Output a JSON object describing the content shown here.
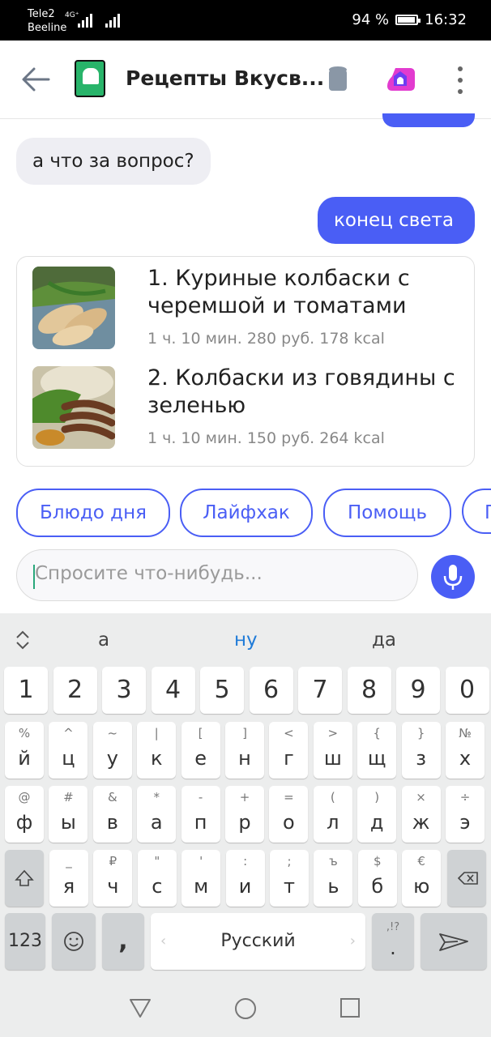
{
  "status_bar": {
    "carrier1": "Tele2",
    "carrier2": "Beeline",
    "network": "4G⁺",
    "battery": "94 %",
    "battery_level": 0.94,
    "time": "16:32"
  },
  "header": {
    "title": "Рецепты Вкусв...",
    "icons": [
      "back-arrow-icon",
      "app-logo-icon",
      "station-icon",
      "alice-icon",
      "more-icon"
    ]
  },
  "chat": {
    "incoming": "а что за вопрос?",
    "outgoing": "конец света",
    "recipes": [
      {
        "title": "1. Куриные колбаски с черемшой и томатами",
        "meta": "1 ч. 10 мин. 280 руб. 178 kcal"
      },
      {
        "title": "2. Колбаски из говядины с зеленью",
        "meta": "1 ч. 10 мин. 150 руб. 264 kcal"
      }
    ]
  },
  "chips": [
    "Блюдо дня",
    "Лайфхак",
    "Помощь",
    "П"
  ],
  "input": {
    "placeholder": "Спросите что-нибудь..."
  },
  "keyboard": {
    "suggestions": [
      "а",
      "ну",
      "да"
    ],
    "numbers": [
      "1",
      "2",
      "3",
      "4",
      "5",
      "6",
      "7",
      "8",
      "9",
      "0"
    ],
    "row1": [
      [
        "%",
        "й"
      ],
      [
        "^",
        "ц"
      ],
      [
        "~",
        "у"
      ],
      [
        "|",
        "к"
      ],
      [
        "[",
        "е"
      ],
      [
        "]",
        "н"
      ],
      [
        "<",
        "г"
      ],
      [
        ">",
        "ш"
      ],
      [
        "{",
        "щ"
      ],
      [
        "}",
        "з"
      ],
      [
        "№",
        "х"
      ]
    ],
    "row2": [
      [
        "@",
        "ф"
      ],
      [
        "#",
        "ы"
      ],
      [
        "&",
        "в"
      ],
      [
        "*",
        "а"
      ],
      [
        "-",
        "п"
      ],
      [
        "+",
        "р"
      ],
      [
        "=",
        "о"
      ],
      [
        "(",
        "л"
      ],
      [
        ")",
        "д"
      ],
      [
        "×",
        "ж"
      ],
      [
        "÷",
        "э"
      ]
    ],
    "row3": [
      [
        "_",
        "я"
      ],
      [
        "₽",
        "ч"
      ],
      [
        "\"",
        "с"
      ],
      [
        "'",
        "м"
      ],
      [
        ":",
        "и"
      ],
      [
        ";",
        "т"
      ],
      [
        "ъ",
        "ь"
      ],
      [
        "$",
        "б"
      ],
      [
        "€",
        "ю"
      ]
    ],
    "num_key": "123",
    "comma": ",",
    "space": "Русский",
    "period_sub": ",!?",
    "period": "."
  },
  "colors": {
    "accent": "#4a5ef5",
    "app_green": "#28b46a"
  }
}
